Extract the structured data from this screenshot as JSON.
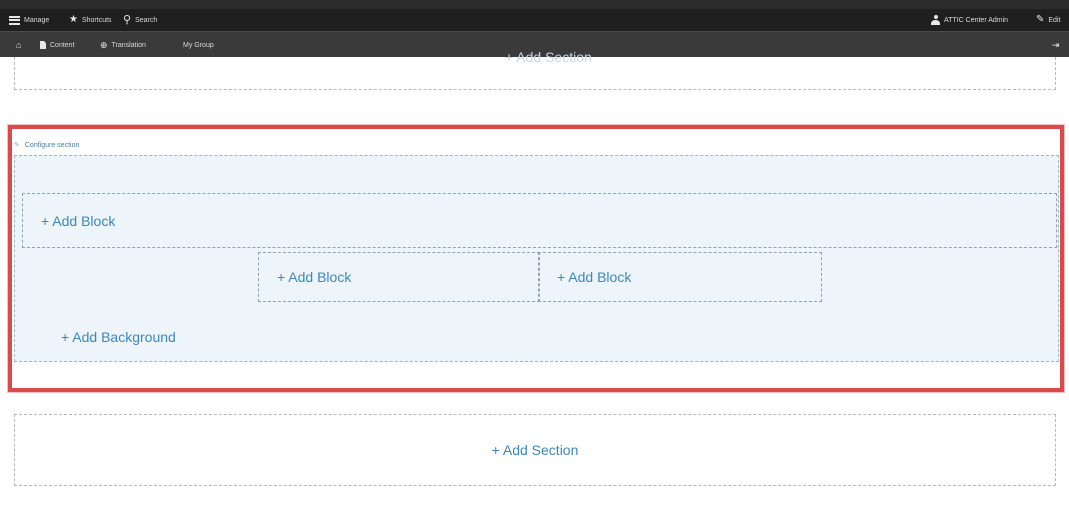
{
  "toolbar": {
    "manage_label": "Manage",
    "shortcuts_label": "Shortcuts",
    "search_label": "Search",
    "user_label": "ATTIC Center Admin",
    "edit_label": "Edit",
    "content_label": "Content",
    "translation_label": "Translation",
    "my_group_label": "My Group",
    "icons": {
      "manage": "hamburger-icon",
      "shortcuts": "star-icon",
      "search": "search-icon",
      "user": "user-icon",
      "edit": "pencil-icon",
      "home": "home-icon",
      "content": "document-icon",
      "translation": "globe-icon",
      "orientation": "orientation-toggle-icon"
    }
  },
  "layout_builder": {
    "previous_section_ghost_label": "+ Add Section",
    "configure_section_label": "Configure section",
    "add_block_top_label": "+ Add Block",
    "add_block_left_label": "+ Add Block",
    "add_block_right_label": "+ Add Block",
    "add_background_label": "+ Add Background",
    "add_section_label": "+ Add Section"
  },
  "colors": {
    "toolbar_bg": "#2c2c2c",
    "highlight_border": "#d94a4a",
    "link_blue": "#3e86b8",
    "section_bg": "#edf5fb"
  }
}
